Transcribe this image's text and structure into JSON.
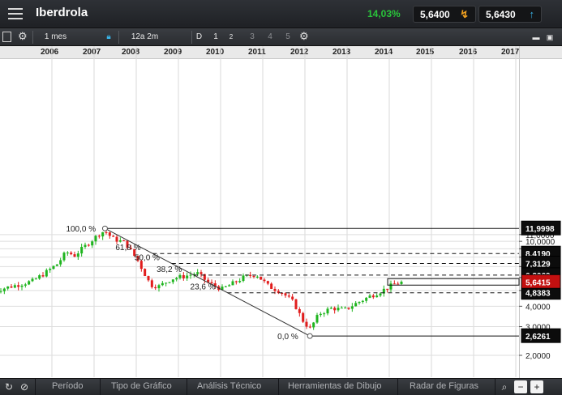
{
  "header": {
    "title": "Iberdrola",
    "change_pct": "14,03%",
    "bid": "5,6400",
    "ask": "5,6430",
    "bid_icon": "arrow-down-icon",
    "ask_icon": "arrow-up-icon"
  },
  "toolbar": {
    "period": "1 mes",
    "range": "12a 2m",
    "mode": "D",
    "n1": "1",
    "n2": "2",
    "n3": "3",
    "n4": "4",
    "n5": "5"
  },
  "footer": {
    "tabs": [
      "Período",
      "Tipo de Gráfico",
      "Análisis Técnico",
      "Herramientas de Dibujo",
      "Radar de Figuras"
    ]
  },
  "colors": {
    "up": "#1fb51f",
    "down": "#e11d1d",
    "price_tag": "#c41010",
    "accent_green": "#29c43a"
  },
  "chart_data": {
    "type": "candlestick",
    "title": "",
    "x_years": [
      "2006",
      "2007",
      "2008",
      "2009",
      "2010",
      "2011",
      "2012",
      "2013",
      "2014",
      "2015",
      "2016",
      "2017"
    ],
    "y_ticks": [
      "2,0000",
      "3,0000",
      "4,0000",
      "5,0000",
      "6,0000",
      "7,0000",
      "8,0000",
      "9,0000",
      "10,0000",
      "11,0000"
    ],
    "ylim": [
      1.6,
      13.0
    ],
    "y_scale": "log",
    "grid": true,
    "last_price": "5,6415",
    "fibonacci": {
      "high": {
        "label": "100,0 %",
        "value": 11.9998,
        "tag": "11,9998",
        "date": "2007.72"
      },
      "low": {
        "label": "0,0 %",
        "value": 2.6261,
        "tag": "2,6261",
        "date": "2012.58"
      },
      "levels": [
        {
          "label": "61,8 %",
          "value": 8.419,
          "tag": "8,4190"
        },
        {
          "label": "50,0 %",
          "value": 7.3129,
          "tag": "7,3129"
        },
        {
          "label": "38,2 %",
          "value": 6.2069,
          "tag": "6,2069"
        },
        {
          "label": "23,6 %",
          "value": 4.8383,
          "tag": "4,8383"
        }
      ]
    },
    "monthly_close": [
      {
        "t": 2005.0,
        "v": 4.9
      },
      {
        "t": 2005.5,
        "v": 5.3
      },
      {
        "t": 2006.0,
        "v": 5.7
      },
      {
        "t": 2006.3,
        "v": 6.4
      },
      {
        "t": 2006.6,
        "v": 7.3
      },
      {
        "t": 2006.8,
        "v": 8.6
      },
      {
        "t": 2007.0,
        "v": 8.2
      },
      {
        "t": 2007.3,
        "v": 9.6
      },
      {
        "t": 2007.6,
        "v": 11.2
      },
      {
        "t": 2007.72,
        "v": 11.6
      },
      {
        "t": 2007.9,
        "v": 10.4
      },
      {
        "t": 2008.2,
        "v": 9.8
      },
      {
        "t": 2008.5,
        "v": 7.6
      },
      {
        "t": 2008.8,
        "v": 5.4
      },
      {
        "t": 2009.0,
        "v": 5.3
      },
      {
        "t": 2009.3,
        "v": 5.9
      },
      {
        "t": 2009.6,
        "v": 6.1
      },
      {
        "t": 2009.9,
        "v": 6.4
      },
      {
        "t": 2010.2,
        "v": 5.5
      },
      {
        "t": 2010.5,
        "v": 5.1
      },
      {
        "t": 2010.8,
        "v": 5.6
      },
      {
        "t": 2011.0,
        "v": 6.0
      },
      {
        "t": 2011.3,
        "v": 6.3
      },
      {
        "t": 2011.6,
        "v": 5.3
      },
      {
        "t": 2011.9,
        "v": 4.9
      },
      {
        "t": 2012.2,
        "v": 4.2
      },
      {
        "t": 2012.4,
        "v": 3.3
      },
      {
        "t": 2012.58,
        "v": 2.9
      },
      {
        "t": 2012.8,
        "v": 3.6
      },
      {
        "t": 2013.1,
        "v": 3.9
      },
      {
        "t": 2013.4,
        "v": 3.8
      },
      {
        "t": 2013.7,
        "v": 4.2
      },
      {
        "t": 2014.0,
        "v": 4.6
      },
      {
        "t": 2014.3,
        "v": 5.0
      },
      {
        "t": 2014.6,
        "v": 5.5
      },
      {
        "t": 2014.8,
        "v": 5.64
      }
    ]
  }
}
